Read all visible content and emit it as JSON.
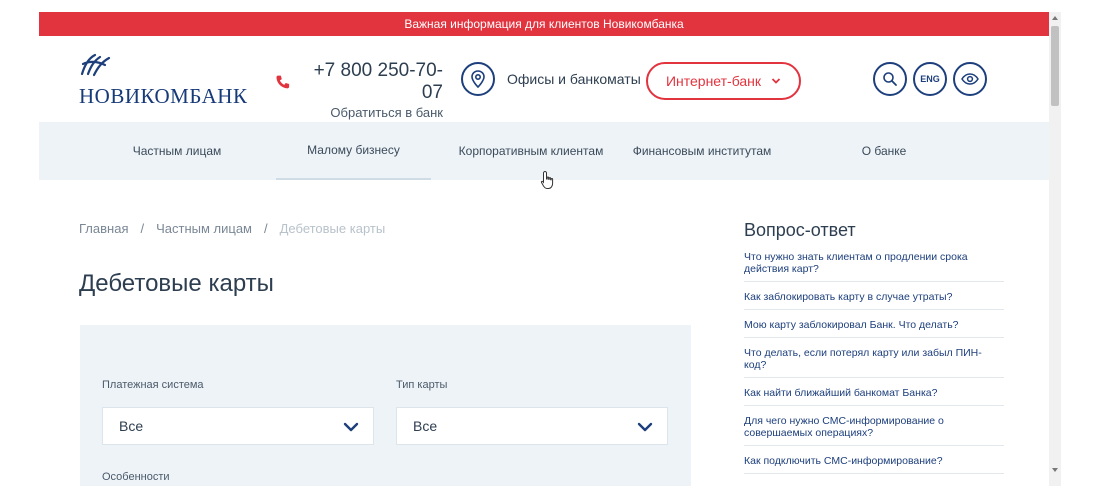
{
  "alert": {
    "text": "Важная информация для клиентов Новикомбанка"
  },
  "header": {
    "logo_text": "НОВИКОМБАНК",
    "phone": "+7 800 250-70-07",
    "phone_sub": "Обратиться в банк",
    "offices_label": "Офисы и банкоматы",
    "ibank_label": "Интернет-банк",
    "lang_label": "ENG",
    "icons": [
      "phone-icon",
      "location-pin-icon",
      "chevron-down-icon",
      "search-icon",
      "eye-icon"
    ]
  },
  "nav": {
    "items": [
      {
        "label": "Частным лицам"
      },
      {
        "label": "Малому бизнесу"
      },
      {
        "label": "Корпоративным клиентам"
      },
      {
        "label": "Финансовым институтам"
      },
      {
        "label": "О банке"
      }
    ]
  },
  "breadcrumb": {
    "home": "Главная",
    "section": "Частным лицам",
    "current": "Дебетовые карты",
    "separator": "/"
  },
  "page": {
    "title": "Дебетовые карты"
  },
  "filters": {
    "payment_system_label": "Платежная система",
    "payment_system_value": "Все",
    "card_type_label": "Тип карты",
    "card_type_value": "Все",
    "features_label": "Особенности"
  },
  "faq": {
    "title": "Вопрос-ответ",
    "items": [
      "Что нужно знать клиентам о продлении срока действия карт?",
      "Как заблокировать карту в случае утраты?",
      "Мою карту заблокировал Банк. Что делать?",
      "Что делать, если потерял карту или забыл ПИН-код?",
      "Как найти ближайший банкомат Банка?",
      "Для чего нужно СМС-информирование о совершаемых операциях?",
      "Как подключить СМС-информирование?"
    ]
  },
  "colors": {
    "brand_red": "#e1343f",
    "brand_blue": "#1d3f7c",
    "panel_bg": "#eef3f7"
  }
}
